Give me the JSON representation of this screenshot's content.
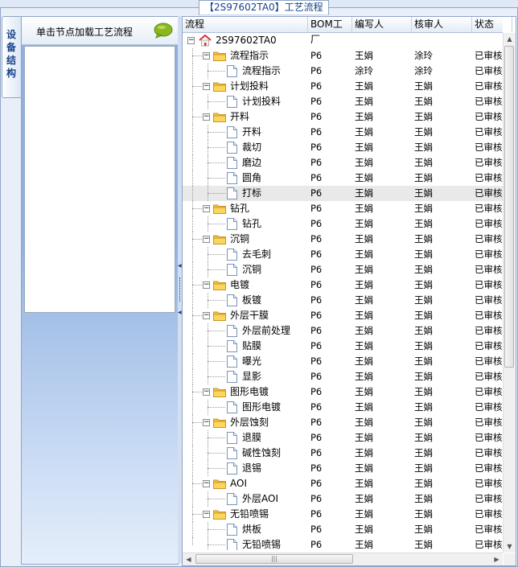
{
  "window": {
    "title": "【2S97602TA0】工艺流程"
  },
  "side_tab": {
    "label": "设备结构"
  },
  "left_panel": {
    "hint": "单击节点加载工艺流程"
  },
  "grid": {
    "columns": [
      "流程",
      "BOM工厂",
      "编写人",
      "核审人",
      "状态"
    ],
    "rows": [
      {
        "level": 0,
        "type": "root",
        "name": "2S97602TA0",
        "factory": "",
        "writer": "",
        "reviewer": "",
        "status": ""
      },
      {
        "level": 1,
        "type": "folder",
        "name": "流程指示",
        "factory": "P6",
        "writer": "王娟",
        "reviewer": "涂玲",
        "status": "已审核"
      },
      {
        "level": 2,
        "type": "doc",
        "name": "流程指示",
        "factory": "P6",
        "writer": "涂玲",
        "reviewer": "涂玲",
        "status": "已审核"
      },
      {
        "level": 1,
        "type": "folder",
        "name": "计划投料",
        "factory": "P6",
        "writer": "王娟",
        "reviewer": "王娟",
        "status": "已审核"
      },
      {
        "level": 2,
        "type": "doc",
        "name": "计划投料",
        "factory": "P6",
        "writer": "王娟",
        "reviewer": "王娟",
        "status": "已审核"
      },
      {
        "level": 1,
        "type": "folder",
        "name": "开料",
        "factory": "P6",
        "writer": "王娟",
        "reviewer": "王娟",
        "status": "已审核"
      },
      {
        "level": 2,
        "type": "doc",
        "name": "开料",
        "factory": "P6",
        "writer": "王娟",
        "reviewer": "王娟",
        "status": "已审核"
      },
      {
        "level": 2,
        "type": "doc",
        "name": "裁切",
        "factory": "P6",
        "writer": "王娟",
        "reviewer": "王娟",
        "status": "已审核"
      },
      {
        "level": 2,
        "type": "doc",
        "name": "磨边",
        "factory": "P6",
        "writer": "王娟",
        "reviewer": "王娟",
        "status": "已审核"
      },
      {
        "level": 2,
        "type": "doc",
        "name": "圆角",
        "factory": "P6",
        "writer": "王娟",
        "reviewer": "王娟",
        "status": "已审核"
      },
      {
        "level": 2,
        "type": "doc",
        "name": "打标",
        "factory": "P6",
        "writer": "王娟",
        "reviewer": "王娟",
        "status": "已审核",
        "selected": true
      },
      {
        "level": 1,
        "type": "folder",
        "name": "钻孔",
        "factory": "P6",
        "writer": "王娟",
        "reviewer": "王娟",
        "status": "已审核"
      },
      {
        "level": 2,
        "type": "doc",
        "name": "钻孔",
        "factory": "P6",
        "writer": "王娟",
        "reviewer": "王娟",
        "status": "已审核"
      },
      {
        "level": 1,
        "type": "folder",
        "name": "沉铜",
        "factory": "P6",
        "writer": "王娟",
        "reviewer": "王娟",
        "status": "已审核"
      },
      {
        "level": 2,
        "type": "doc",
        "name": "去毛刺",
        "factory": "P6",
        "writer": "王娟",
        "reviewer": "王娟",
        "status": "已审核"
      },
      {
        "level": 2,
        "type": "doc",
        "name": "沉铜",
        "factory": "P6",
        "writer": "王娟",
        "reviewer": "王娟",
        "status": "已审核"
      },
      {
        "level": 1,
        "type": "folder",
        "name": "电镀",
        "factory": "P6",
        "writer": "王娟",
        "reviewer": "王娟",
        "status": "已审核"
      },
      {
        "level": 2,
        "type": "doc",
        "name": "板镀",
        "factory": "P6",
        "writer": "王娟",
        "reviewer": "王娟",
        "status": "已审核"
      },
      {
        "level": 1,
        "type": "folder",
        "name": "外层干膜",
        "factory": "P6",
        "writer": "王娟",
        "reviewer": "王娟",
        "status": "已审核"
      },
      {
        "level": 2,
        "type": "doc",
        "name": "外层前处理",
        "factory": "P6",
        "writer": "王娟",
        "reviewer": "王娟",
        "status": "已审核"
      },
      {
        "level": 2,
        "type": "doc",
        "name": "贴膜",
        "factory": "P6",
        "writer": "王娟",
        "reviewer": "王娟",
        "status": "已审核"
      },
      {
        "level": 2,
        "type": "doc",
        "name": "曝光",
        "factory": "P6",
        "writer": "王娟",
        "reviewer": "王娟",
        "status": "已审核"
      },
      {
        "level": 2,
        "type": "doc",
        "name": "显影",
        "factory": "P6",
        "writer": "王娟",
        "reviewer": "王娟",
        "status": "已审核"
      },
      {
        "level": 1,
        "type": "folder",
        "name": "图形电镀",
        "factory": "P6",
        "writer": "王娟",
        "reviewer": "王娟",
        "status": "已审核"
      },
      {
        "level": 2,
        "type": "doc",
        "name": "图形电镀",
        "factory": "P6",
        "writer": "王娟",
        "reviewer": "王娟",
        "status": "已审核"
      },
      {
        "level": 1,
        "type": "folder",
        "name": "外层蚀刻",
        "factory": "P6",
        "writer": "王娟",
        "reviewer": "王娟",
        "status": "已审核"
      },
      {
        "level": 2,
        "type": "doc",
        "name": "退膜",
        "factory": "P6",
        "writer": "王娟",
        "reviewer": "王娟",
        "status": "已审核"
      },
      {
        "level": 2,
        "type": "doc",
        "name": "碱性蚀刻",
        "factory": "P6",
        "writer": "王娟",
        "reviewer": "王娟",
        "status": "已审核"
      },
      {
        "level": 2,
        "type": "doc",
        "name": "退锡",
        "factory": "P6",
        "writer": "王娟",
        "reviewer": "王娟",
        "status": "已审核"
      },
      {
        "level": 1,
        "type": "folder",
        "name": "AOI",
        "factory": "P6",
        "writer": "王娟",
        "reviewer": "王娟",
        "status": "已审核"
      },
      {
        "level": 2,
        "type": "doc",
        "name": "外层AOI",
        "factory": "P6",
        "writer": "王娟",
        "reviewer": "王娟",
        "status": "已审核"
      },
      {
        "level": 1,
        "type": "folder",
        "name": "无铅喷锡",
        "factory": "P6",
        "writer": "王娟",
        "reviewer": "王娟",
        "status": "已审核"
      },
      {
        "level": 2,
        "type": "doc",
        "name": "烘板",
        "factory": "P6",
        "writer": "王娟",
        "reviewer": "王娟",
        "status": "已审核"
      },
      {
        "level": 2,
        "type": "doc",
        "name": "无铅喷锡",
        "factory": "P6",
        "writer": "王娟",
        "reviewer": "王娟",
        "status": "已审核"
      }
    ]
  },
  "icons": {
    "expand": "minus-box-icon",
    "folder": "folder-icon",
    "doc": "document-icon",
    "root": "home-icon",
    "bubble": "speech-bubble-icon"
  },
  "colors": {
    "accent": "#15428b",
    "folder": "#f5c33b",
    "bubble": "#8bb81e",
    "root": "#d9342b"
  }
}
